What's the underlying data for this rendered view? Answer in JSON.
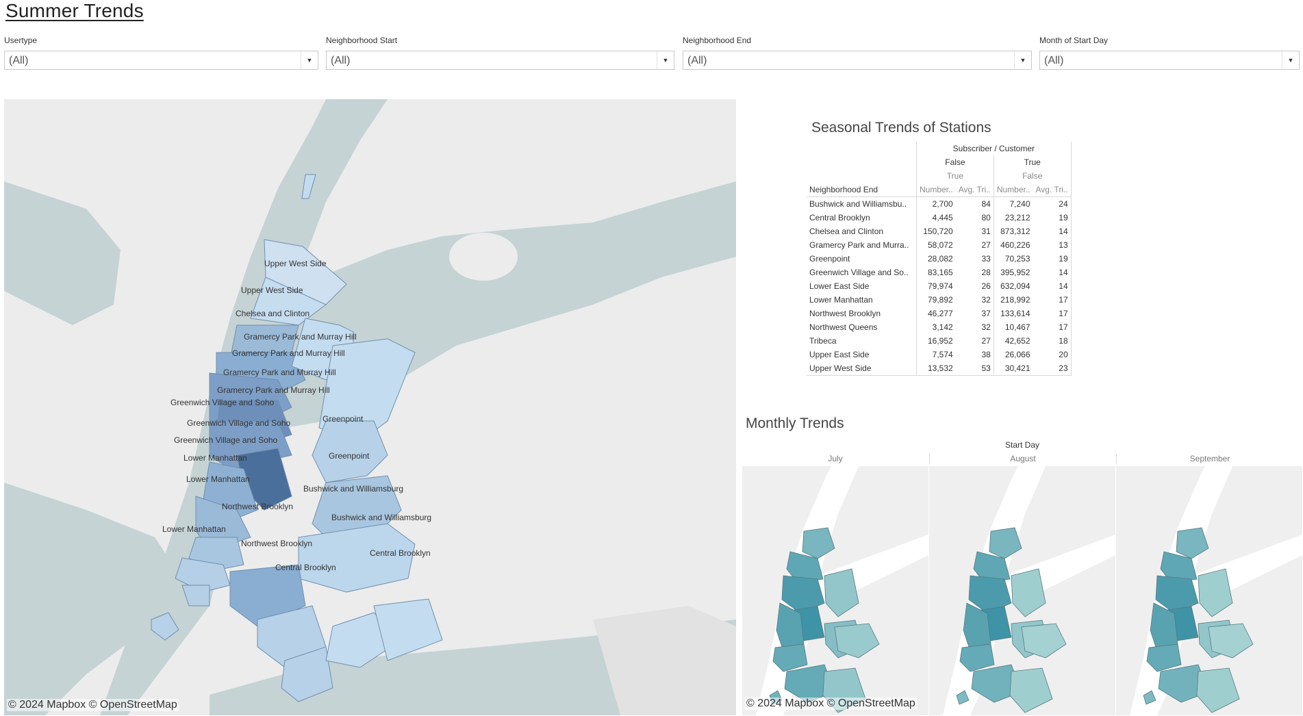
{
  "dashboard": {
    "title": "Summer Trends"
  },
  "filters": [
    {
      "label": "Usertype",
      "value": "(All)"
    },
    {
      "label": "Neighborhood Start",
      "value": "(All)"
    },
    {
      "label": "Neighborhood End",
      "value": "(All)"
    },
    {
      "label": "Month of Start Day",
      "value": "(All)"
    }
  ],
  "main_map": {
    "credit": "© 2024 Mapbox © OpenStreetMap",
    "labels": [
      "Upper West Side",
      "Upper West Side",
      "Chelsea and Clinton",
      "Gramercy Park and Murray Hill",
      "Gramercy Park and Murray Hill",
      "Gramercy Park and Murray Hill",
      "Gramercy Park and Murray Hill",
      "Greenwich Village and Soho",
      "Greenwich Village and Soho",
      "Greenwich Village and Soho",
      "Lower Manhattan",
      "Lower Manhattan",
      "Lower Manhattan",
      "Greenpoint",
      "Greenpoint",
      "Bushwick and Williamsburg",
      "Bushwick and Williamsburg",
      "Northwest Brooklyn",
      "Northwest Brooklyn",
      "Central Brooklyn",
      "Central Brooklyn"
    ]
  },
  "seasonal": {
    "title": "Seasonal Trends of Stations",
    "header_top": "Subscriber / Customer",
    "groups": [
      "False",
      "True"
    ],
    "subgroups": [
      "True",
      "False"
    ],
    "row_header": "Neighborhood End",
    "col_headers": [
      "Number..",
      "Avg. Tri..",
      "Number..",
      "Avg. Tri.."
    ],
    "rows": [
      {
        "name": "Bushwick and Williamsbu..",
        "v": [
          "2,700",
          "84",
          "7,240",
          "24"
        ]
      },
      {
        "name": "Central Brooklyn",
        "v": [
          "4,445",
          "80",
          "23,212",
          "19"
        ]
      },
      {
        "name": "Chelsea and Clinton",
        "v": [
          "150,720",
          "31",
          "873,312",
          "14"
        ]
      },
      {
        "name": "Gramercy Park and Murra..",
        "v": [
          "58,072",
          "27",
          "460,226",
          "13"
        ]
      },
      {
        "name": "Greenpoint",
        "v": [
          "28,082",
          "33",
          "70,253",
          "19"
        ]
      },
      {
        "name": "Greenwich Village and So..",
        "v": [
          "83,165",
          "28",
          "395,952",
          "14"
        ]
      },
      {
        "name": "Lower East Side",
        "v": [
          "79,974",
          "26",
          "632,094",
          "14"
        ]
      },
      {
        "name": "Lower Manhattan",
        "v": [
          "79,892",
          "32",
          "218,992",
          "17"
        ]
      },
      {
        "name": "Northwest Brooklyn",
        "v": [
          "46,277",
          "37",
          "133,614",
          "17"
        ]
      },
      {
        "name": "Northwest Queens",
        "v": [
          "3,142",
          "32",
          "10,467",
          "17"
        ]
      },
      {
        "name": "Tribeca",
        "v": [
          "16,952",
          "27",
          "42,652",
          "18"
        ]
      },
      {
        "name": "Upper East Side",
        "v": [
          "7,574",
          "38",
          "26,066",
          "20"
        ]
      },
      {
        "name": "Upper West Side",
        "v": [
          "13,532",
          "53",
          "30,421",
          "23"
        ]
      }
    ]
  },
  "monthly": {
    "title": "Monthly Trends",
    "axis_title": "Start Day",
    "months": [
      "July",
      "August",
      "September"
    ],
    "credit": "© 2024 Mapbox © OpenStreetMap"
  },
  "colors": {
    "water": "#c5d3d5",
    "land": "#ececec",
    "blue_dark": "#4a6f9a",
    "blue_light": "#c4dcef",
    "teal_dark": "#3f93a6",
    "teal_light": "#bfe1dd"
  }
}
